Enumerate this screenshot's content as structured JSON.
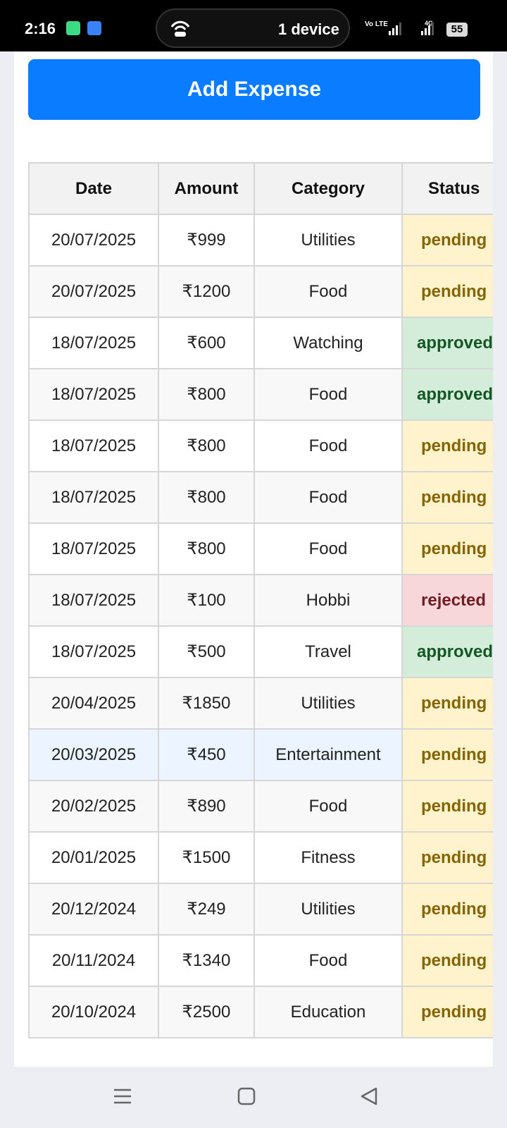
{
  "status_bar": {
    "time": "2:16",
    "pill_text": "1 device",
    "volte": "Vo LTE",
    "network": "4G",
    "battery": "55"
  },
  "actions": {
    "add_expense_label": "Add Expense"
  },
  "table": {
    "headers": [
      "Date",
      "Amount",
      "Category",
      "Status"
    ],
    "rows": [
      {
        "date": "20/07/2025",
        "amount": "₹999",
        "category": "Utilities",
        "status": "pending"
      },
      {
        "date": "20/07/2025",
        "amount": "₹1200",
        "category": "Food",
        "status": "pending"
      },
      {
        "date": "18/07/2025",
        "amount": "₹600",
        "category": "Watching",
        "status": "approved"
      },
      {
        "date": "18/07/2025",
        "amount": "₹800",
        "category": "Food",
        "status": "approved"
      },
      {
        "date": "18/07/2025",
        "amount": "₹800",
        "category": "Food",
        "status": "pending"
      },
      {
        "date": "18/07/2025",
        "amount": "₹800",
        "category": "Food",
        "status": "pending"
      },
      {
        "date": "18/07/2025",
        "amount": "₹800",
        "category": "Food",
        "status": "pending"
      },
      {
        "date": "18/07/2025",
        "amount": "₹100",
        "category": "Hobbi",
        "status": "rejected"
      },
      {
        "date": "18/07/2025",
        "amount": "₹500",
        "category": "Travel",
        "status": "approved"
      },
      {
        "date": "20/04/2025",
        "amount": "₹1850",
        "category": "Utilities",
        "status": "pending"
      },
      {
        "date": "20/03/2025",
        "amount": "₹450",
        "category": "Entertainment",
        "status": "pending"
      },
      {
        "date": "20/02/2025",
        "amount": "₹890",
        "category": "Food",
        "status": "pending"
      },
      {
        "date": "20/01/2025",
        "amount": "₹1500",
        "category": "Fitness",
        "status": "pending"
      },
      {
        "date": "20/12/2024",
        "amount": "₹249",
        "category": "Utilities",
        "status": "pending"
      },
      {
        "date": "20/11/2024",
        "amount": "₹1340",
        "category": "Food",
        "status": "pending"
      },
      {
        "date": "20/10/2024",
        "amount": "₹2500",
        "category": "Education",
        "status": "pending"
      }
    ]
  },
  "colors": {
    "accent": "#0a7cff",
    "pending_bg": "#fff3cd",
    "approved_bg": "#d4edda",
    "rejected_bg": "#f8d7da"
  },
  "icons": {
    "nav_recents": "menu-lines-icon",
    "nav_home": "home-square-icon",
    "nav_back": "back-triangle-icon"
  }
}
